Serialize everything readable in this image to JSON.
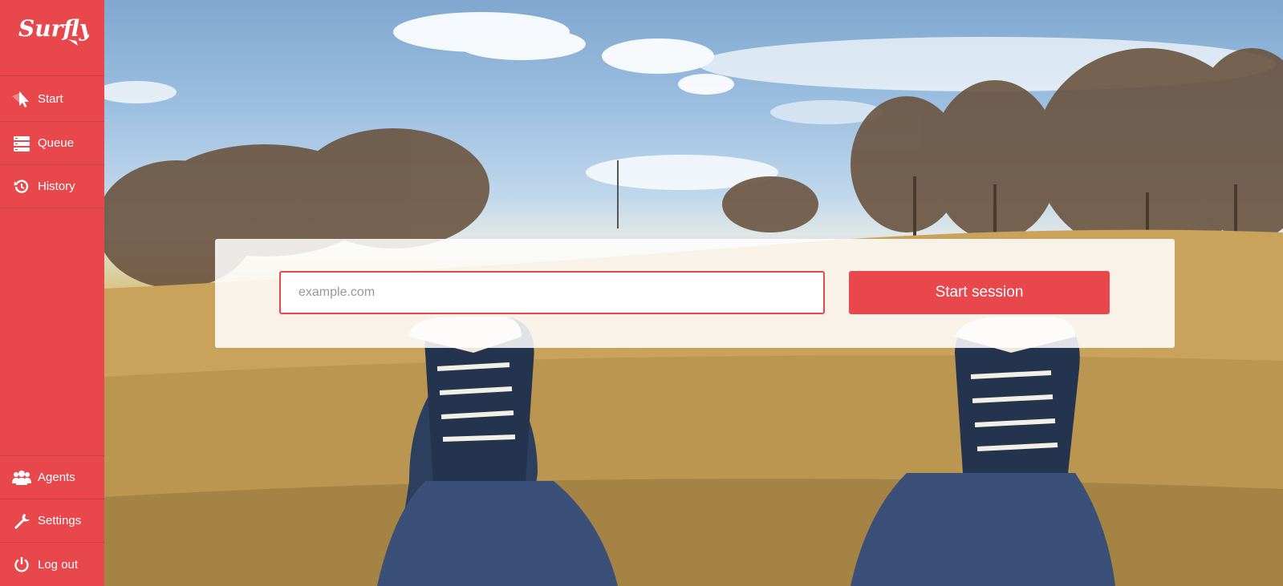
{
  "brand": {
    "logo_text": "Surfly",
    "accent_color": "#e8474b"
  },
  "nav": {
    "top": [
      {
        "label": "Start",
        "icon": "cursor-icon",
        "active": true
      },
      {
        "label": "Queue",
        "icon": "queue-icon"
      },
      {
        "label": "History",
        "icon": "history-icon"
      }
    ],
    "bottom": [
      {
        "label": "Agents",
        "icon": "agents-icon"
      },
      {
        "label": "Settings",
        "icon": "wrench-icon"
      },
      {
        "label": "Log out",
        "icon": "power-icon"
      }
    ]
  },
  "start_form": {
    "url_placeholder": "example.com",
    "url_value": "",
    "button_label": "Start session"
  }
}
